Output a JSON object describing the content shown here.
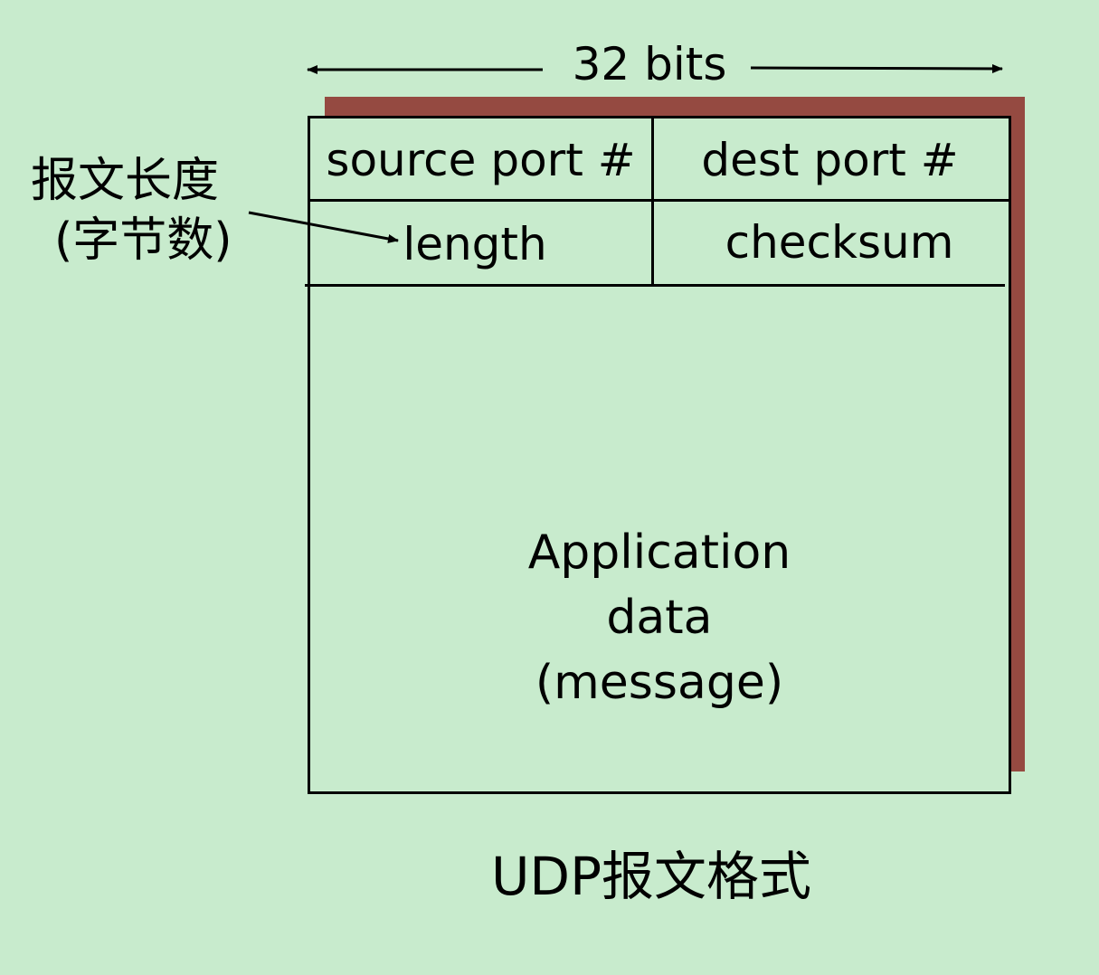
{
  "width_label": "32 bits",
  "header": {
    "source_port": "source port #",
    "dest_port": "dest port #",
    "length": "length",
    "checksum": "checksum"
  },
  "payload": {
    "line1": "Application",
    "line2": "data",
    "line3": "(message)"
  },
  "annotation": {
    "line1": "报文长度",
    "line2": "(字节数)"
  },
  "caption": "UDP报文格式",
  "colors": {
    "background": "#c8ebcd",
    "shadow": "#954a41",
    "stroke": "#000000"
  }
}
